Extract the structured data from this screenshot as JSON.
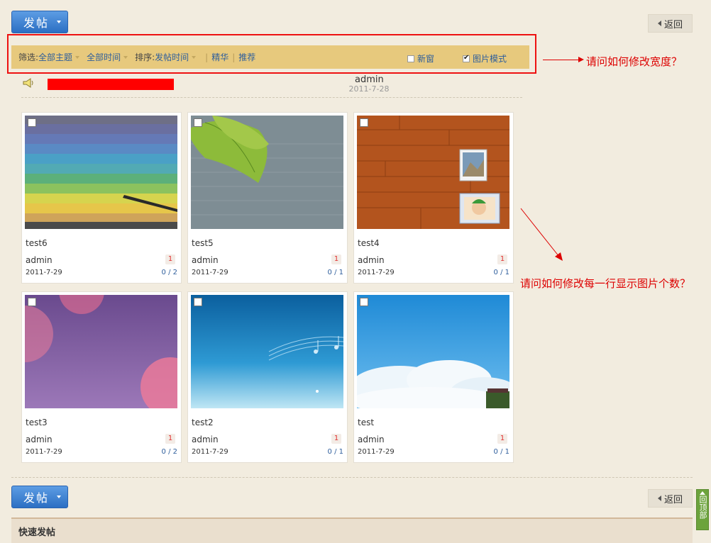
{
  "toolbar": {
    "post_label": "发帖",
    "back_label": "返回"
  },
  "filter": {
    "filter_label": "筛选:",
    "topic": "全部主题",
    "time": "全部时间",
    "sort_label": "排序:",
    "sort_value": "发帖时间",
    "digest": "精华",
    "recommend": "推荐",
    "new_window": "新窗",
    "image_mode": "图片模式",
    "new_window_checked": false,
    "image_mode_checked": true
  },
  "annotations": {
    "width_question": "请问如何修改宽度？",
    "per_row_question": "请问如何修改每一行显示图片个数？"
  },
  "announcement": {
    "user": "admin",
    "date": "2011-7-28"
  },
  "cards": [
    {
      "title": "test6",
      "author": "admin",
      "badge": "1",
      "date": "2011-7-29",
      "stats": "0 / 2",
      "image": "stripes"
    },
    {
      "title": "test5",
      "author": "admin",
      "badge": "1",
      "date": "2011-7-29",
      "stats": "0 / 1",
      "image": "leaf-wall"
    },
    {
      "title": "test4",
      "author": "admin",
      "badge": "1",
      "date": "2011-7-29",
      "stats": "0 / 1",
      "image": "wood-photos"
    },
    {
      "title": "test3",
      "author": "admin",
      "badge": "1",
      "date": "2011-7-29",
      "stats": "0 / 2",
      "image": "purple-bokeh"
    },
    {
      "title": "test2",
      "author": "admin",
      "badge": "1",
      "date": "2011-7-29",
      "stats": "0 / 1",
      "image": "blue-music"
    },
    {
      "title": "test",
      "author": "admin",
      "badge": "1",
      "date": "2011-7-29",
      "stats": "0 / 1",
      "image": "sky-clouds"
    }
  ],
  "footer": {
    "quick_post": "快速发帖",
    "back_to_top": "回顶部"
  },
  "colors": {
    "accent": "#2c6fc3",
    "filter_bg": "#e7c97d",
    "annotation": "#dd0000",
    "top_button": "#6ca33c"
  }
}
